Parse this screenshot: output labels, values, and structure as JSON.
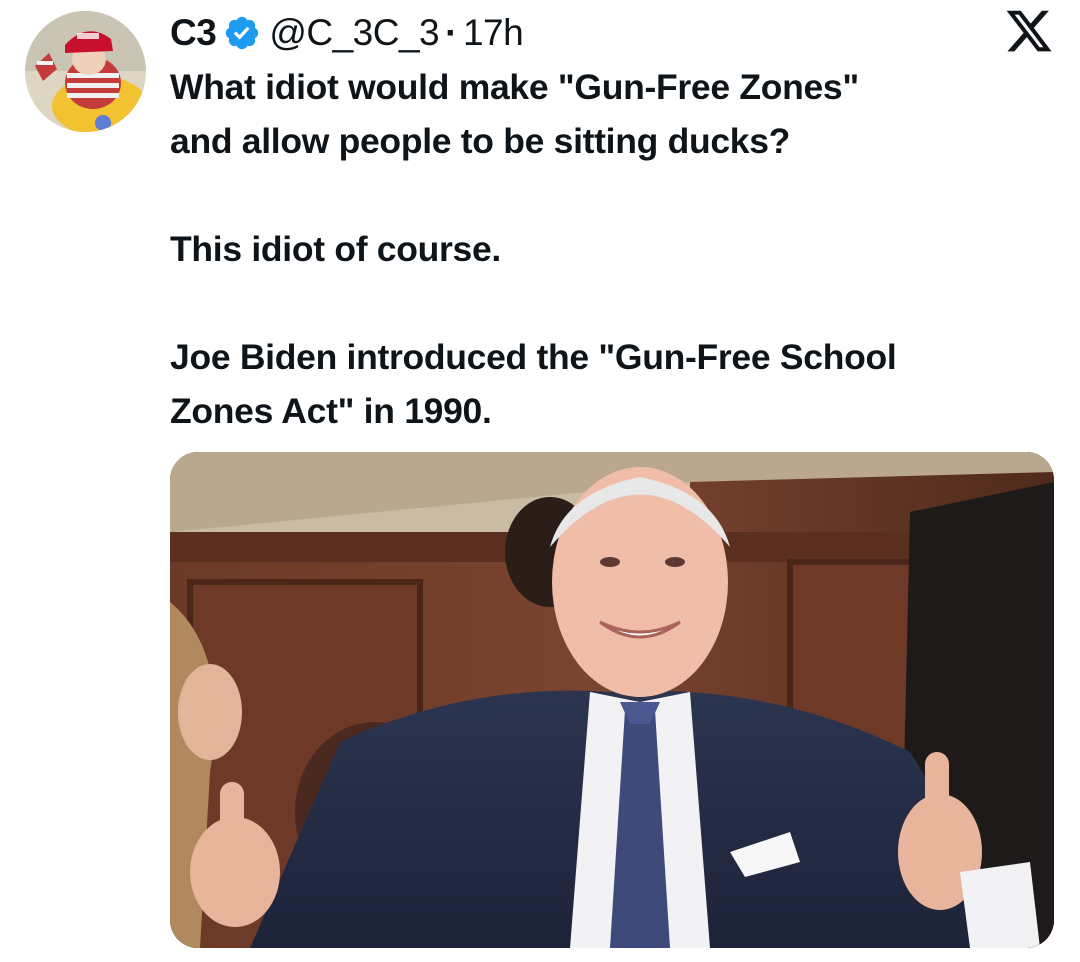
{
  "tweet": {
    "display_name": "C3",
    "handle": "@C_3C_3",
    "separator": "·",
    "time": "17h",
    "verified": true,
    "badge_color": "#1d9bf0",
    "lines": [
      "What idiot would make \"Gun-Free Zones\"",
      "and allow people to be sitting ducks?",
      "This idiot of course.",
      "Joe Biden introduced the \"Gun-Free School",
      "Zones Act\" in 1990."
    ],
    "icons": {
      "verified": "verified-badge-icon",
      "platform": "x-logo-icon"
    },
    "media_alt": "photo"
  }
}
